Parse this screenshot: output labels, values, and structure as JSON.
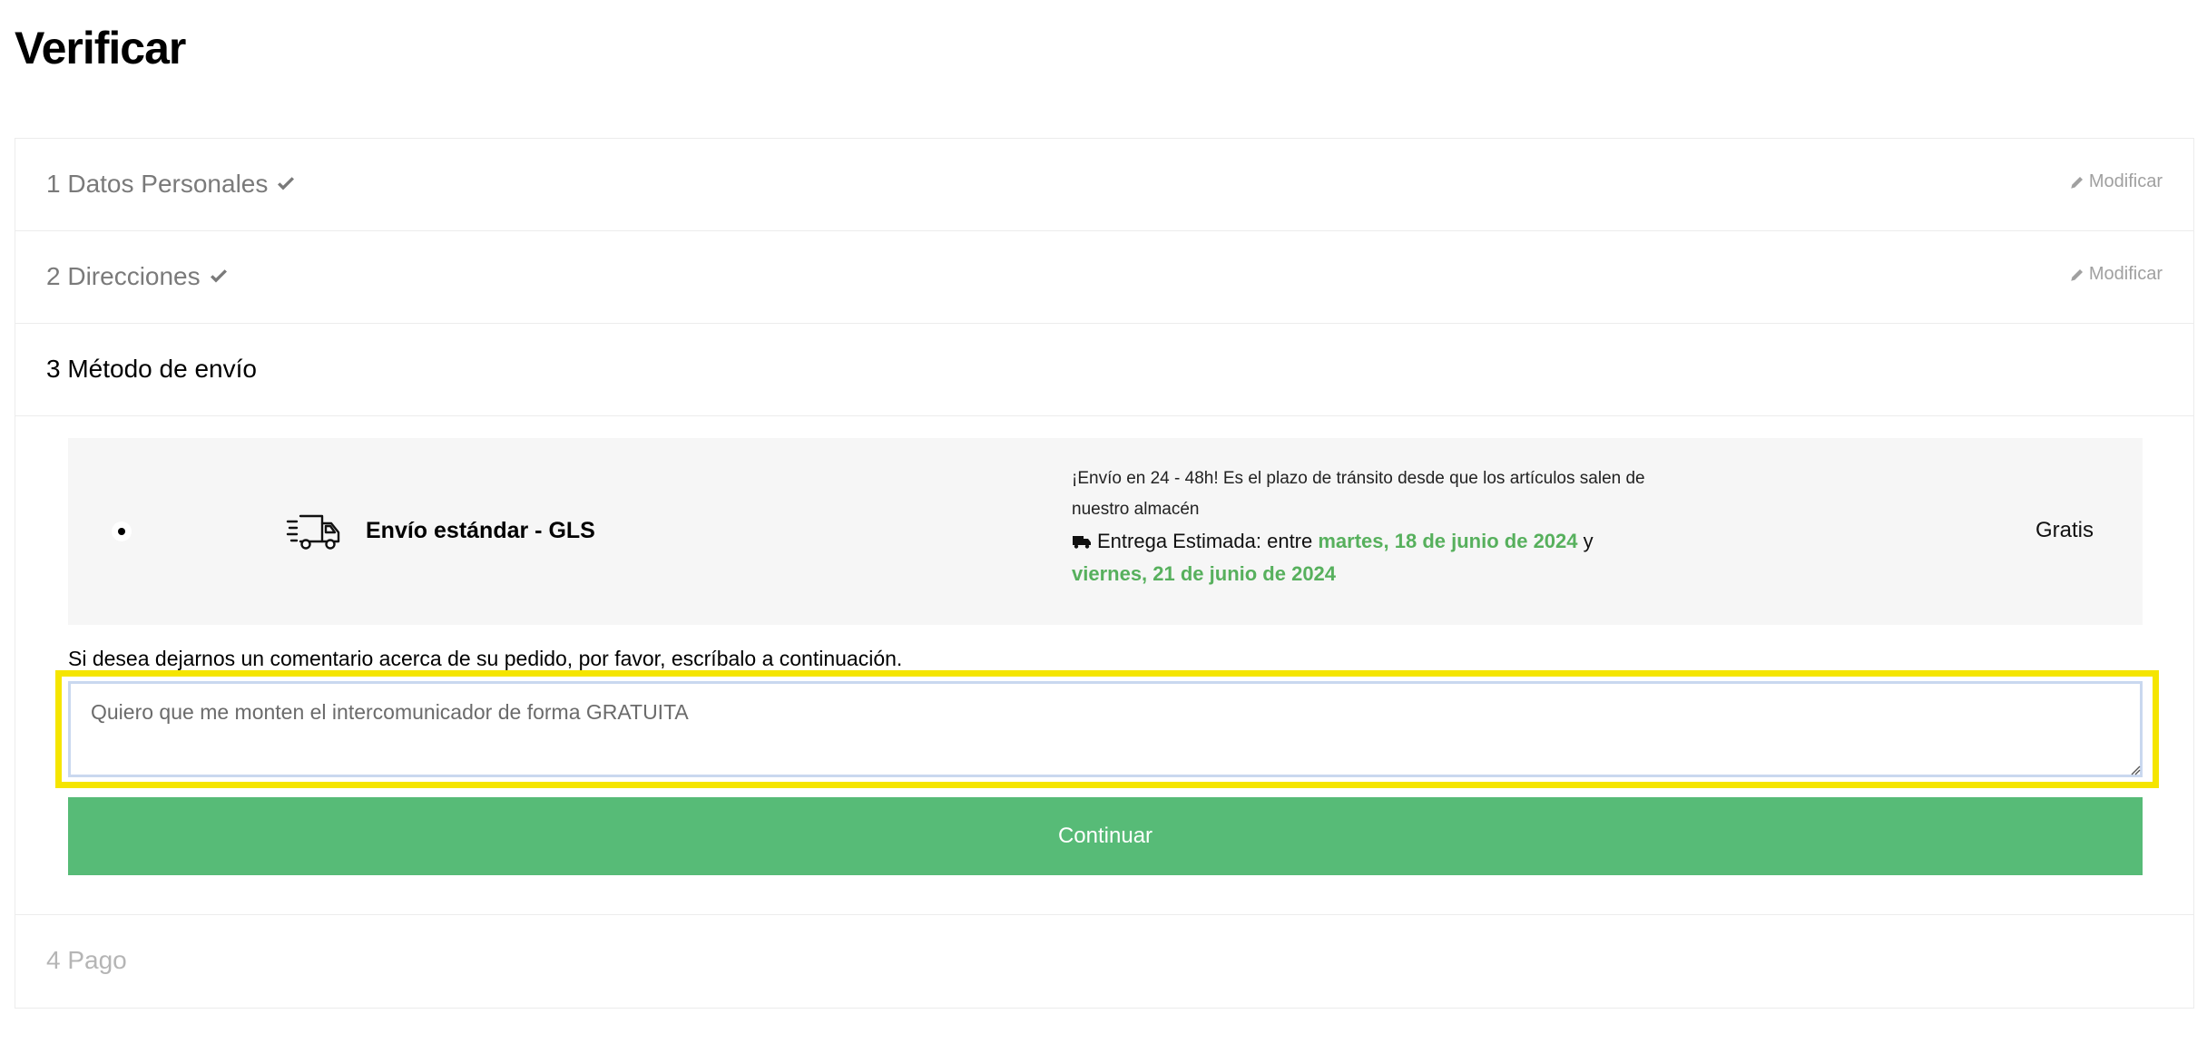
{
  "page": {
    "title": "Verificar"
  },
  "steps": [
    {
      "label": "1 Datos Personales",
      "state": "completed",
      "edit_label": "Modificar"
    },
    {
      "label": "2 Direcciones",
      "state": "completed",
      "edit_label": "Modificar"
    },
    {
      "label": "3 Método de envío",
      "state": "active"
    },
    {
      "label": "4 Pago",
      "state": "disabled"
    }
  ],
  "shipping": {
    "carrier_name": "Envío estándar - GLS",
    "carrier_icon": "delivery-truck-icon",
    "delay_text": "¡Envío en 24 - 48h! Es el plazo de tránsito desde que los artículos salen de nuestro almacén",
    "estimate_prefix": "Entrega Estimada: entre",
    "estimate_from": "martes, 18 de junio de 2024",
    "estimate_joiner": "y",
    "estimate_to": "viernes, 21 de junio de 2024",
    "price": "Gratis",
    "selected": true,
    "colors": {
      "date_highlight": "#57b05d",
      "row_background": "#f6f6f6"
    }
  },
  "comment": {
    "label": "Si desea dejarnos un comentario acerca de su pedido, por favor, escríbalo a continuación.",
    "value": "Quiero que me monten el intercomunicador de forma GRATUITA",
    "highlight_color": "#f5e500"
  },
  "actions": {
    "continue_label": "Continuar",
    "continue_color": "#57bb77"
  }
}
